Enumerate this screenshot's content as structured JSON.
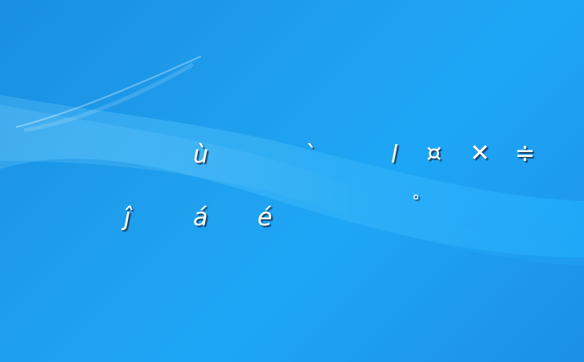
{
  "wallpaper": {
    "colors": {
      "base_top": "#1a8ee0",
      "base_mid": "#1ea6f6",
      "base_bottom": "#1c8fe6",
      "wave_light": "#3cb6f8",
      "streak": "#ffffff"
    }
  },
  "glyphs": {
    "row1": [
      "ù",
      "`",
      "l",
      "¤",
      "✕",
      "≑"
    ],
    "row2": [
      "ĵ",
      "á",
      "é",
      "°"
    ]
  }
}
